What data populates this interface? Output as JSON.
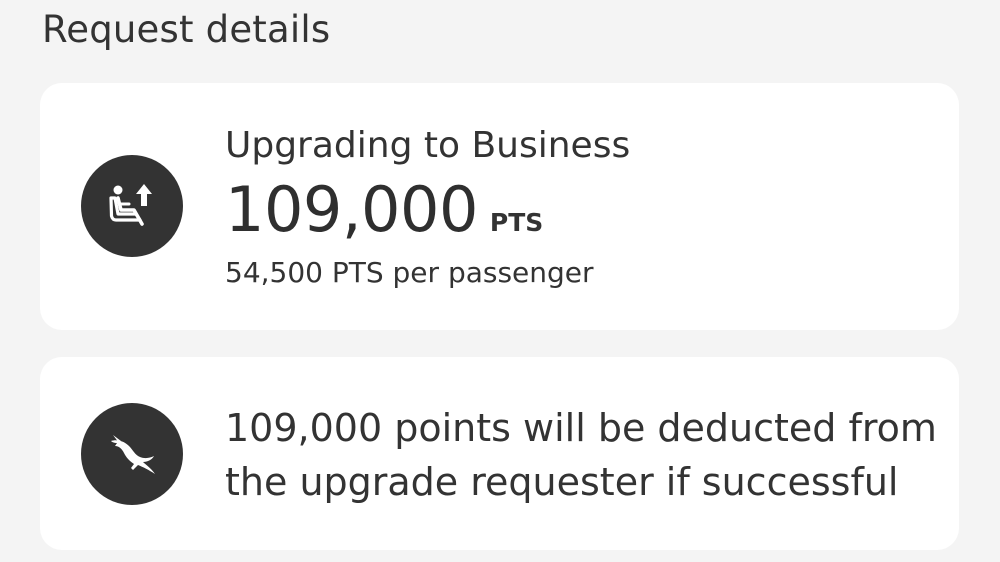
{
  "section": {
    "title": "Request details"
  },
  "upgrade": {
    "icon": "seat-upgrade-icon",
    "title": "Upgrading to Business",
    "points_value": "109,000",
    "points_unit": "PTS",
    "per_passenger": "54,500 PTS per passenger"
  },
  "info": {
    "icon": "kangaroo-logo-icon",
    "line1": "109,000 points will be deducted from",
    "line2": "the upgrade requester if successful"
  },
  "colors": {
    "background": "#f4f4f4",
    "card": "#ffffff",
    "icon_circle": "#333333",
    "text": "#333333"
  }
}
